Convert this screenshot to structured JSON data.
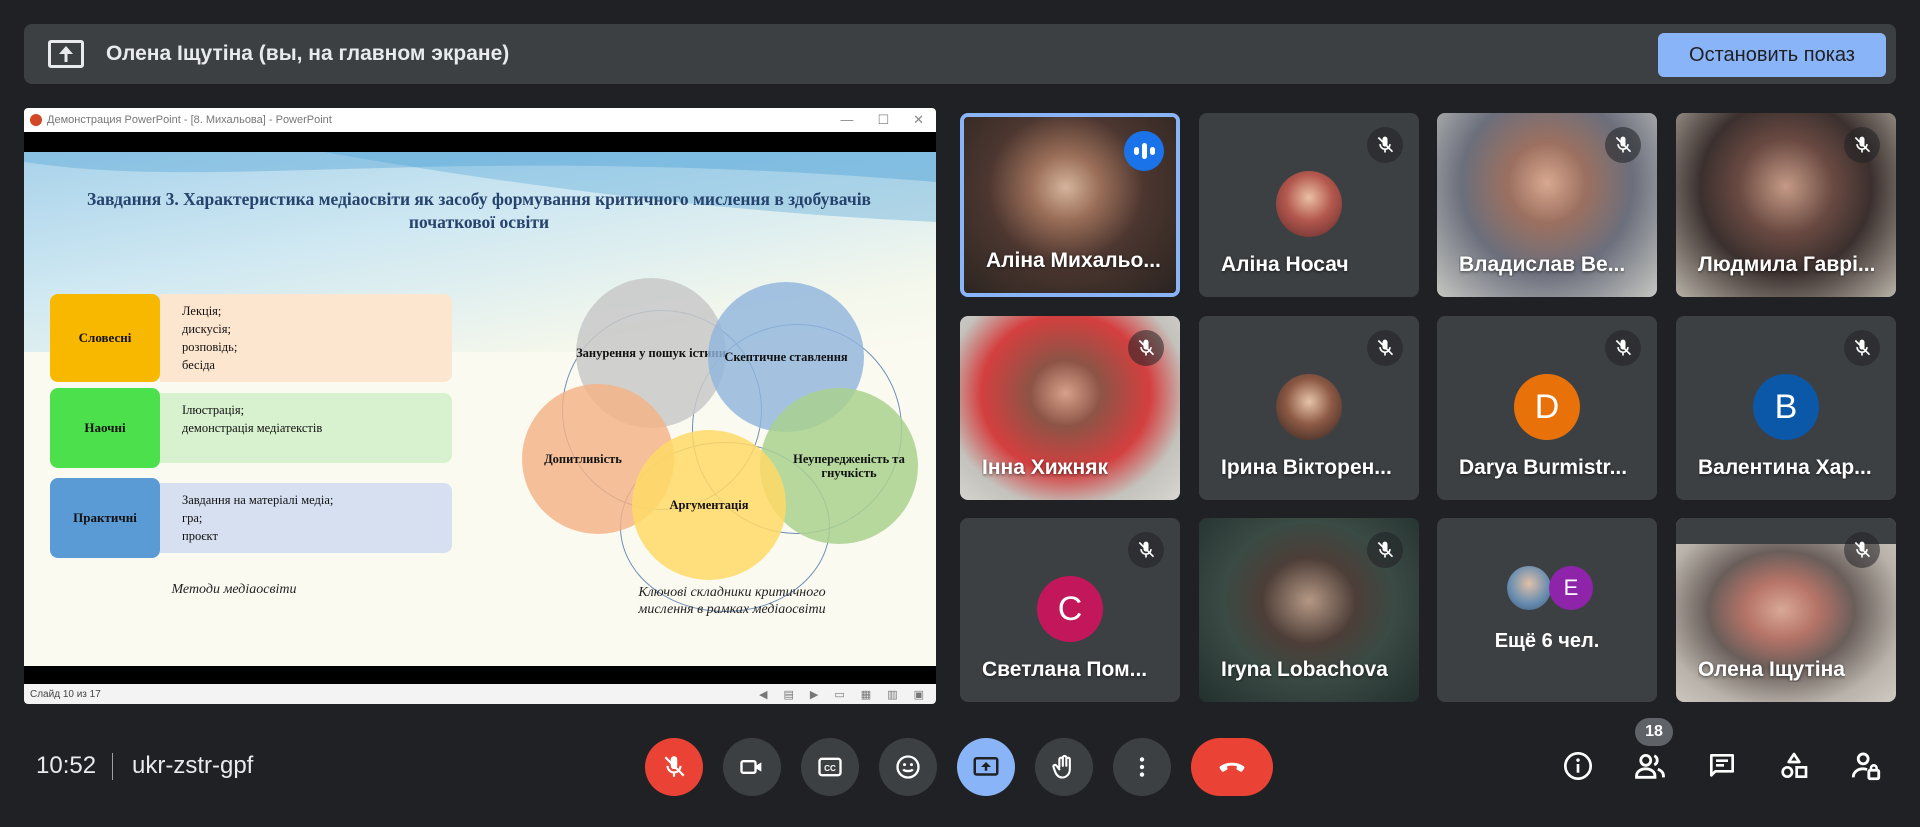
{
  "presenting": {
    "label": "Олена Іщутіна (вы, на главном экране)",
    "stop_button": "Остановить показ"
  },
  "shared_screen": {
    "window_title": "Демонстрация PowerPoint - [8. Михальова] - PowerPoint",
    "status_text": "Слайд 10 из 17",
    "slide": {
      "title": "Завдання 3. Характеристика медіаосвіти як засобу формування критичного мислення в здобувачів початкової освіти",
      "methods": [
        {
          "tag": "Словесні",
          "items": "Лекція;\nдискусія;\nрозповідь;\nбесіда",
          "tag_color": "#f8b800",
          "body_color": "#fde6cf"
        },
        {
          "tag": "Наочні",
          "items": "Ілюстрація;\nдемонстрація медіатекстів",
          "tag_color": "#4ce04c",
          "body_color": "#d8f2d0"
        },
        {
          "tag": "Практичні",
          "items": "Завдання на матеріалі медіа;\nгра;\nпроєкт",
          "tag_color": "#5b9bd5",
          "body_color": "#d6e0f0"
        }
      ],
      "methods_caption": "Методи медіаосвіти",
      "circles": [
        {
          "label": "Занурення у пошук істини",
          "color": "#c8c8c8"
        },
        {
          "label": "Скептичне ставлення",
          "color": "#8fb4dc"
        },
        {
          "label": "Допитливість",
          "color": "#f4b183"
        },
        {
          "label": "Неупередженість та гнучкість",
          "color": "#a9d18e"
        },
        {
          "label": "Аргументація",
          "color": "#ffd966"
        }
      ],
      "circles_caption": "Ключові складники критичного мислення в рамках медіаосвіти"
    }
  },
  "participants": [
    {
      "name": "Аліна Михальо...",
      "type": "video",
      "speaking": true
    },
    {
      "name": "Аліна Носач",
      "type": "photo",
      "muted": true
    },
    {
      "name": "Владислав Ве...",
      "type": "video",
      "muted": true
    },
    {
      "name": "Людмила Гаврі...",
      "type": "video",
      "muted": true
    },
    {
      "name": "Інна Хижняк",
      "type": "video",
      "muted": true
    },
    {
      "name": "Ірина Вікторен...",
      "type": "photo",
      "muted": true
    },
    {
      "name": "Darya Burmistr...",
      "type": "letter",
      "letter": "D",
      "color": "#e8710a",
      "muted": true
    },
    {
      "name": "Валентина Хар...",
      "type": "letter",
      "letter": "В",
      "color": "#0b57a8",
      "muted": true
    },
    {
      "name": "Светлана Пом...",
      "type": "letter",
      "letter": "С",
      "color": "#c2185b",
      "muted": true
    },
    {
      "name": "Iryna Lobachova",
      "type": "video",
      "muted": true
    },
    {
      "name": "Олена Іщутіна",
      "type": "video",
      "muted": true
    }
  ],
  "more_tile": {
    "text": "Ещё 6 чел.",
    "letter": "E",
    "letter_color": "#8e24aa"
  },
  "bottom_bar": {
    "time": "10:52",
    "meeting_code": "ukr-zstr-gpf",
    "participants_count": "18"
  }
}
